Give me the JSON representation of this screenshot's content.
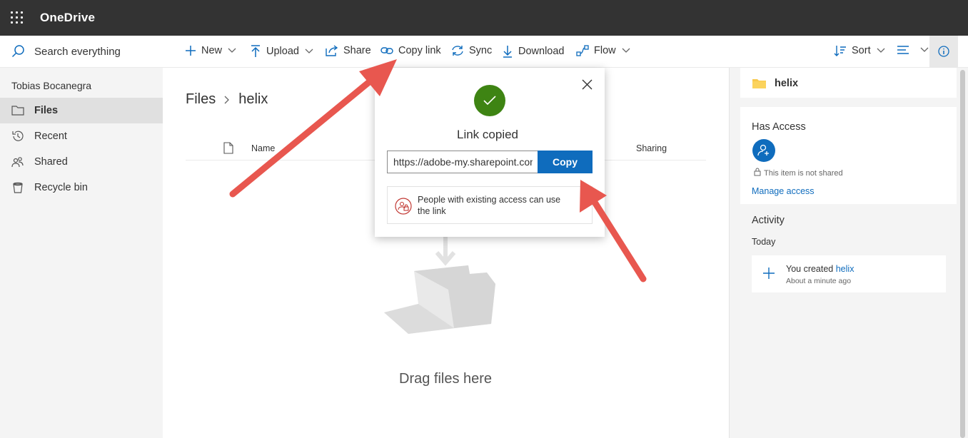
{
  "app": {
    "title": "OneDrive"
  },
  "search": {
    "label": "Search everything"
  },
  "commands": {
    "new": "New",
    "upload": "Upload",
    "share": "Share",
    "copy_link": "Copy link",
    "sync": "Sync",
    "download": "Download",
    "flow": "Flow",
    "sort": "Sort"
  },
  "nav": {
    "user": "Tobias Bocanegra",
    "items": [
      {
        "label": "Files",
        "icon": "folder-icon",
        "active": true
      },
      {
        "label": "Recent",
        "icon": "history-icon",
        "active": false
      },
      {
        "label": "Shared",
        "icon": "people-icon",
        "active": false
      },
      {
        "label": "Recycle bin",
        "icon": "recycle-bin-icon",
        "active": false
      }
    ]
  },
  "breadcrumb": {
    "root": "Files",
    "current": "helix"
  },
  "list": {
    "col_name": "Name",
    "col_sharing": "Sharing"
  },
  "empty": {
    "message": "Drag files here"
  },
  "dialog": {
    "title": "Link copied",
    "link_value": "https://adobe-my.sharepoint.com/:f:/g/personal/",
    "copy_label": "Copy",
    "permission_text": "People with existing access can use the link"
  },
  "details": {
    "folder_name": "helix",
    "has_access_heading": "Has Access",
    "not_shared": "This item is not shared",
    "manage_access": "Manage access",
    "activity_heading": "Activity",
    "today": "Today",
    "activity_prefix": "You created ",
    "activity_item": "helix",
    "activity_time": "About a minute ago"
  },
  "colors": {
    "topbar": "#333333",
    "accent": "#0f6cbd",
    "success": "#3e8413",
    "annotation_arrow": "#e8574f"
  }
}
